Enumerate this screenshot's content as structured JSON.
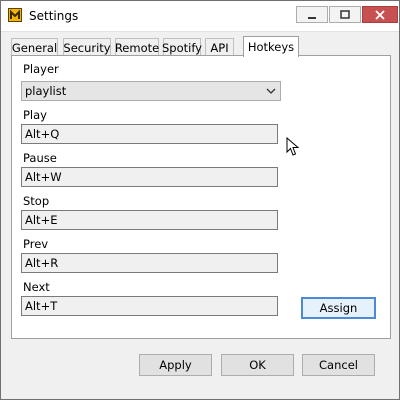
{
  "window": {
    "title": "Settings"
  },
  "tabs": [
    {
      "label": "General"
    },
    {
      "label": "Security"
    },
    {
      "label": "Remote"
    },
    {
      "label": "Spotify"
    },
    {
      "label": "API"
    },
    {
      "label": "Hotkeys"
    }
  ],
  "active_tab": "Hotkeys",
  "form": {
    "player_label": "Player",
    "player_value": "playlist",
    "play_label": "Play",
    "play_value": "Alt+Q",
    "pause_label": "Pause",
    "pause_value": "Alt+W",
    "stop_label": "Stop",
    "stop_value": "Alt+E",
    "prev_label": "Prev",
    "prev_value": "Alt+R",
    "next_label": "Next",
    "next_value": "Alt+T",
    "assign_label": "Assign"
  },
  "footer": {
    "apply_label": "Apply",
    "ok_label": "OK",
    "cancel_label": "Cancel"
  },
  "colors": {
    "accent": "#4a8ad6",
    "close_button": "#c75050"
  }
}
